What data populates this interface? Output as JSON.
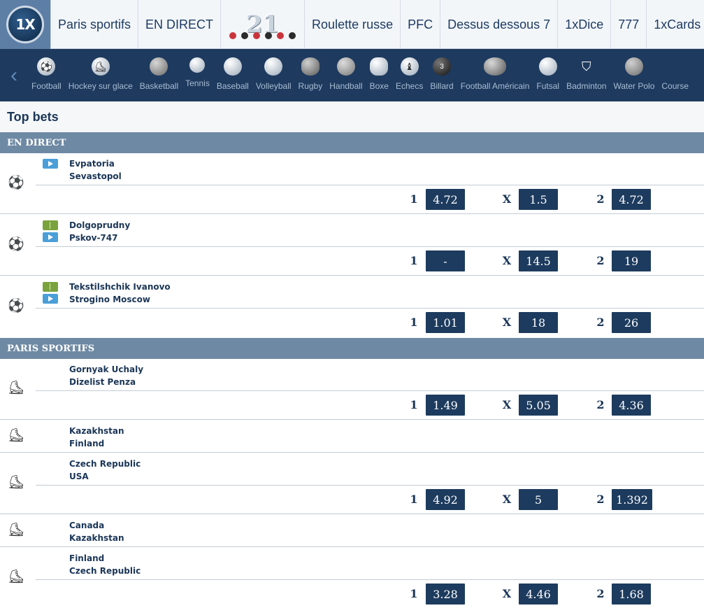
{
  "topnav": {
    "logo_text": "1X",
    "items": [
      {
        "label": "Paris sportifs"
      },
      {
        "label": "EN DIRECT"
      },
      {
        "label": "21"
      },
      {
        "label": "Roulette russe"
      },
      {
        "label": "PFC"
      },
      {
        "label": "Dessus dessous 7"
      },
      {
        "label": "1xDice"
      },
      {
        "label": "777"
      },
      {
        "label": "1xCards"
      }
    ]
  },
  "sportsbar": {
    "sports": [
      {
        "label": "Football",
        "icon": "football-icon"
      },
      {
        "label": "Hockey sur glace",
        "icon": "ice-skate-icon"
      },
      {
        "label": "Basketball",
        "icon": "basketball-icon"
      },
      {
        "label": "Tennis",
        "icon": "tennis-ball-icon"
      },
      {
        "label": "Baseball",
        "icon": "baseball-icon"
      },
      {
        "label": "Volleyball",
        "icon": "volleyball-icon"
      },
      {
        "label": "Rugby",
        "icon": "rugby-ball-icon"
      },
      {
        "label": "Handball",
        "icon": "handball-icon"
      },
      {
        "label": "Boxe",
        "icon": "boxing-glove-icon"
      },
      {
        "label": "Echecs",
        "icon": "chess-piece-icon"
      },
      {
        "label": "Billard",
        "icon": "billiard-ball-icon"
      },
      {
        "label": "Football Américain",
        "icon": "american-football-icon"
      },
      {
        "label": "Futsal",
        "icon": "futsal-ball-icon"
      },
      {
        "label": "Badminton",
        "icon": "shuttlecock-icon"
      },
      {
        "label": "Water Polo",
        "icon": "water-polo-ball-icon"
      },
      {
        "label": "Course",
        "icon": "racing-icon"
      }
    ]
  },
  "topbets": {
    "title": "Top bets"
  },
  "sections": {
    "live": "EN DIRECT",
    "prematch": "PARIS SPORTIFS"
  },
  "odds_labels": {
    "home": "1",
    "draw": "X",
    "away": "2"
  },
  "matches": [
    {
      "team1": "Evpatoria",
      "team2": "Sevastopol",
      "odd1": "4.72",
      "oddx": "1.5",
      "odd2": "4.72"
    },
    {
      "team1": "Dolgoprudny",
      "team2": "Pskov-747",
      "odd1": "-",
      "oddx": "14.5",
      "odd2": "19"
    },
    {
      "team1": "Tekstilshchik Ivanovo",
      "team2": "Strogino Moscow",
      "odd1": "1.01",
      "oddx": "18",
      "odd2": "26"
    },
    {
      "team1": "Gornyak Uchaly",
      "team2": "Dizelist Penza",
      "odd1": "1.49",
      "oddx": "5.05",
      "odd2": "4.36"
    },
    {
      "team1": "Kazakhstan",
      "team2": "Finland"
    },
    {
      "team1": "Czech Republic",
      "team2": "USA",
      "odd1": "4.92",
      "oddx": "5",
      "odd2": "1.392"
    },
    {
      "team1": "Canada",
      "team2": "Kazakhstan"
    },
    {
      "team1": "Finland",
      "team2": "Czech Republic",
      "odd1": "3.28",
      "oddx": "4.46",
      "odd2": "1.68"
    }
  ]
}
